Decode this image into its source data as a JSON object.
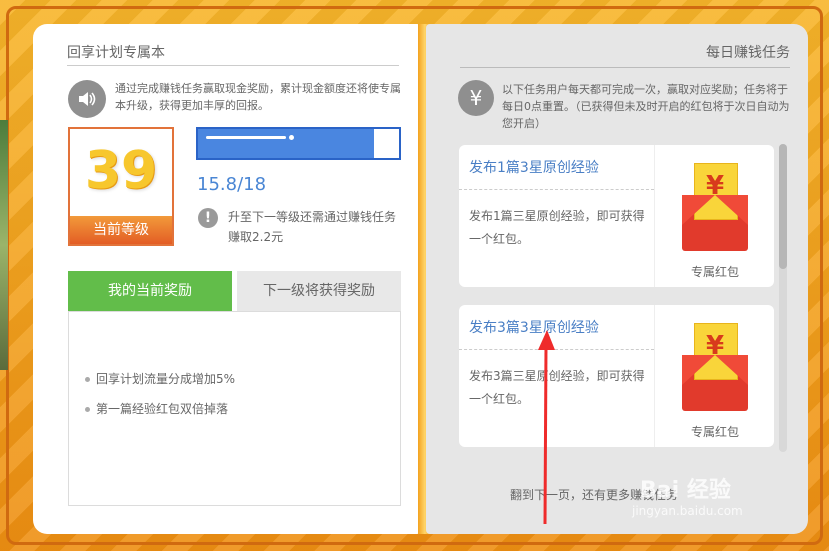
{
  "left": {
    "title": "回享计划专属本",
    "description": "通过完成赚钱任务赢取现金奖励，累计现金额度还将使专属本升级，获得更加丰厚的回报。",
    "level": "39",
    "level_label": "当前等级",
    "progress_text": "15.8/18",
    "progress_fraction": 0.878,
    "upgrade_hint": "升至下一等级还需通过赚钱任务赚取2.2元",
    "tab_current": "我的当前奖励",
    "tab_next": "下一级将获得奖励",
    "rewards": [
      "回享计划流量分成增加5%",
      "第一篇经验红包双倍掉落"
    ]
  },
  "right": {
    "title": "每日赚钱任务",
    "description": "以下任务用户每天都可完成一次，赢取对应奖励；任务将于每日0点重置。（已获得但未及时开启的红包将于次日自动为您开启）",
    "tasks": [
      {
        "title": "发布1篇3星原创经验",
        "body": "发布1篇三星原创经验，即可获得一个红包。",
        "reward": "专属红包"
      },
      {
        "title": "发布3篇3星原创经验",
        "body": "发布3篇三星原创经验，即可获得一个红包。",
        "reward": "专属红包"
      }
    ],
    "next_page_text": "翻到下一页，还有更多赚钱任务"
  },
  "watermark": {
    "text": "Bai 经验",
    "url": "jingyan.baidu.com"
  },
  "colors": {
    "accent_green": "#62bd4a",
    "progress_blue": "#4a86e0",
    "level_orange": "#e35d25",
    "frame_orange": "#f4a21c"
  }
}
